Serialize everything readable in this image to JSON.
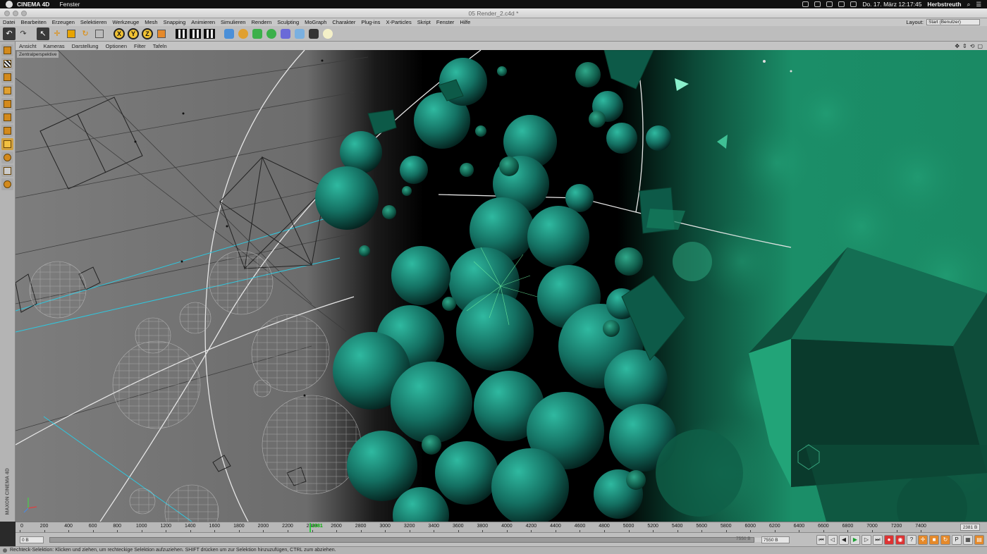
{
  "mac_menubar": {
    "app_name": "CINEMA 4D",
    "menu_fenster": "Fenster",
    "datetime": "Do. 17. März  12:17:45",
    "user": "Herbstreuth"
  },
  "window": {
    "title": "05 Render_2.c4d *"
  },
  "app_menu": {
    "items": [
      "Datei",
      "Bearbeiten",
      "Erzeugen",
      "Selektieren",
      "Werkzeuge",
      "Mesh",
      "Snapping",
      "Animieren",
      "Simulieren",
      "Rendern",
      "Sculpting",
      "MoGraph",
      "Charakter",
      "Plug-ins",
      "X-Particles",
      "Skript",
      "Fenster",
      "Hilfe"
    ],
    "layout_label": "Layout:",
    "layout_value": "Start (Benutzer)"
  },
  "toolbar": {
    "axis_x": "X",
    "axis_y": "Y",
    "axis_z": "Z",
    "icons": [
      "undo-icon",
      "redo-icon",
      "live-selection-icon",
      "move-icon",
      "scale-icon",
      "rotate-icon",
      "recent-tools-icon",
      "x-axis-icon",
      "y-axis-icon",
      "z-axis-icon",
      "coordinate-system-icon",
      "render-view-icon",
      "render-picture-viewer-icon",
      "render-settings-icon",
      "cube-icon",
      "spline-pen-icon",
      "subdivision-icon",
      "array-icon",
      "deformer-icon",
      "floor-icon",
      "camera-icon",
      "light-icon"
    ]
  },
  "viewport_menu": {
    "items": [
      "Ansicht",
      "Kameras",
      "Darstellung",
      "Optionen",
      "Filter",
      "Tafeln"
    ],
    "camera_label": "Zentralperspektive"
  },
  "left_palette": {
    "brand": "MAXON CINEMA 4D",
    "icons": [
      "make-editable-icon",
      "model-mode-icon",
      "texture-mode-icon",
      "workplane-icon",
      "points-mode-icon",
      "edges-mode-icon",
      "polygons-mode-icon",
      "axis-mode-icon",
      "tweak-icon",
      "snap-icon",
      "lock-workplane-icon"
    ]
  },
  "timeline": {
    "ticks": [
      "0",
      "200",
      "400",
      "600",
      "800",
      "1000",
      "1200",
      "1400",
      "1600",
      "1800",
      "2000",
      "2200",
      "2400",
      "2600",
      "2800",
      "3000",
      "3200",
      "3400",
      "3600",
      "3800",
      "4000",
      "4200",
      "4400",
      "4600",
      "4800",
      "5000",
      "5200",
      "5400",
      "5600",
      "5800",
      "6000",
      "6200",
      "6400",
      "6600",
      "6800",
      "7000",
      "7200",
      "7400"
    ],
    "max_frame": 7550,
    "current_frame": 2381,
    "current_label": "2381",
    "frame_field": "2381 B"
  },
  "transport": {
    "start_field": "0 B",
    "range_end_label": "7550 B",
    "end_field": "7550 B",
    "buttons": [
      "go-to-start-icon",
      "previous-key-icon",
      "play-backwards-icon",
      "play-icon",
      "next-key-icon",
      "go-to-end-icon",
      "record-icon",
      "autokey-icon",
      "keyframe-selection-icon",
      "position-key-icon",
      "scale-key-icon",
      "rotation-key-icon",
      "parameter-key-icon",
      "pla-key-icon",
      "motion-system-icon"
    ]
  },
  "status": {
    "text": "Rechteck-Selektion: Klicken und ziehen, um rechteckige Selektion aufzuziehen. SHIFT drücken um zur Selektion hinzuzufügen, CTRL zum abziehen."
  },
  "colors": {
    "accent_teal": "#1fa37a",
    "sphere_teal": "#1c8a7a",
    "wire_cyan": "#2ec8e0",
    "playhead_green": "#2ecc40",
    "tool_orange": "#e5892a"
  }
}
